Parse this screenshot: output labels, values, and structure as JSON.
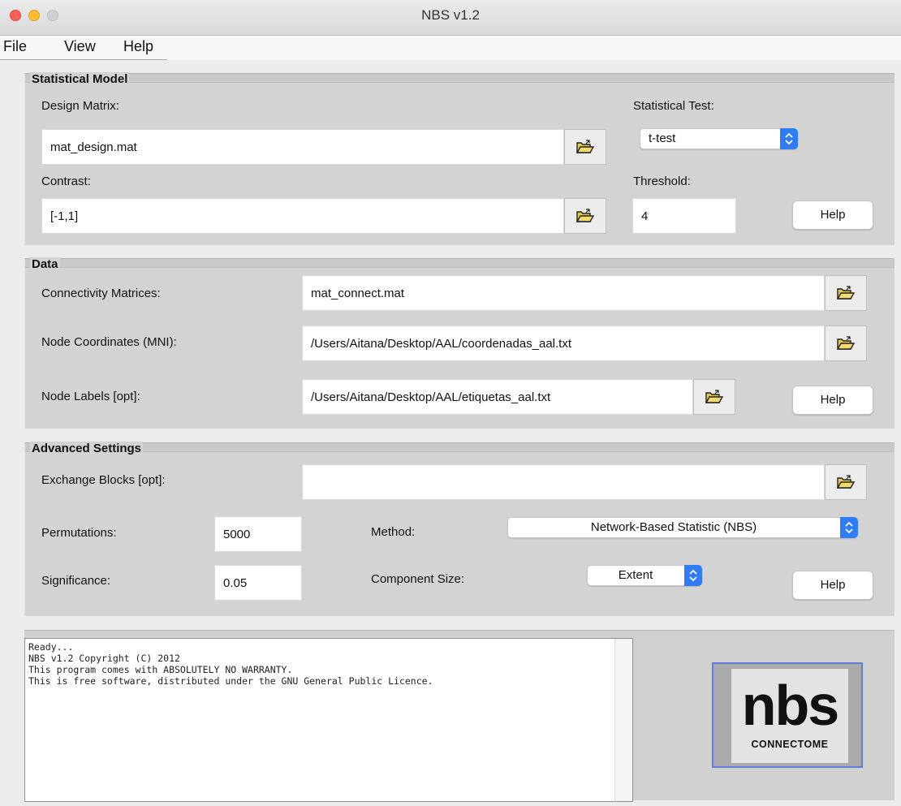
{
  "window": {
    "title": "NBS v1.2",
    "traffic_light_colors": {
      "close": "#fe5f57",
      "minimize": "#febc2e",
      "maximize": "#d0d0d0"
    }
  },
  "menubar": {
    "items": [
      "File",
      "View",
      "Help"
    ]
  },
  "statistical_model": {
    "title": "Statistical Model",
    "design_matrix_label": "Design Matrix:",
    "design_matrix_value": "mat_design.mat",
    "contrast_label": "Contrast:",
    "contrast_value": "[-1,1]",
    "statistical_test_label": "Statistical Test:",
    "statistical_test_value": "t-test",
    "threshold_label": "Threshold:",
    "threshold_value": "4",
    "help_label": "Help"
  },
  "data": {
    "title": "Data",
    "connectivity_label": "Connectivity Matrices:",
    "connectivity_value": "mat_connect.mat",
    "coordinates_label": "Node Coordinates (MNI):",
    "coordinates_value": "/Users/Aitana/Desktop/AAL/coordenadas_aal.txt",
    "labels_label": "Node Labels [opt]:",
    "labels_value": "/Users/Aitana/Desktop/AAL/etiquetas_aal.txt",
    "help_label": "Help"
  },
  "advanced": {
    "title": "Advanced Settings",
    "exchange_label": "Exchange Blocks [opt]:",
    "exchange_value": "",
    "permutations_label": "Permutations:",
    "permutations_value": "5000",
    "significance_label": "Significance:",
    "significance_value": "0.05",
    "method_label": "Method:",
    "method_value": "Network-Based Statistic (NBS)",
    "component_size_label": "Component Size:",
    "component_size_value": "Extent",
    "help_label": "Help"
  },
  "console": {
    "lines": [
      "Ready...",
      "NBS v1.2 Copyright (C) 2012",
      "This program comes with ABSOLUTELY NO WARRANTY.",
      "This is free software, distributed under the GNU General Public Licence."
    ]
  },
  "logo": {
    "main": "nbs",
    "sub": "CONNECTOME"
  },
  "icons": {
    "browse": "open-folder-icon",
    "select": "chevron-updown-icon"
  },
  "colors": {
    "accent": "#2e7cf6",
    "panel": "#d3d3d3",
    "folder": "#e6c84a"
  }
}
